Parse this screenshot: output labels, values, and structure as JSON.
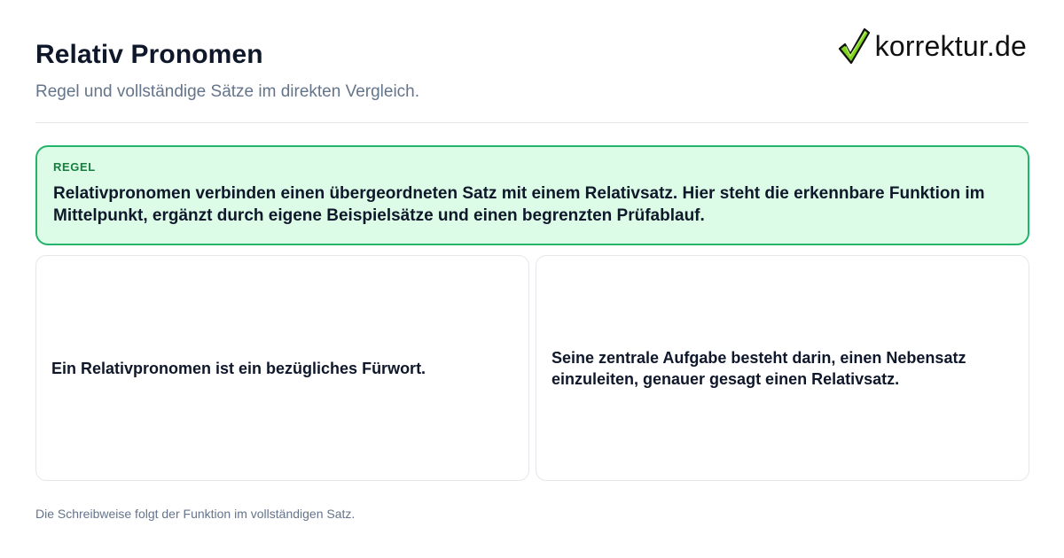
{
  "header": {
    "title": "Relativ Pronomen",
    "subtitle": "Regel und vollständige Sätze im direkten Vergleich."
  },
  "logo": {
    "icon": "checkmark-icon",
    "text": "korrektur.de",
    "check_color": "#7ed321"
  },
  "rule": {
    "label": "REGEL",
    "text": "Relativpronomen verbinden einen übergeordneten Satz mit einem Relativsatz. Hier steht die erkennbare Funktion im Mittelpunkt, ergänzt durch eigene Beispielsätze und einen begrenzten Prüfablauf."
  },
  "cards": [
    {
      "text": "Ein Relativpronomen ist ein bezügliches Fürwort."
    },
    {
      "text": "Seine zentrale Aufgabe besteht darin, einen Nebensatz einzuleiten, genauer gesagt einen Relativsatz."
    }
  ],
  "footer": {
    "note": "Die Schreibweise folgt der Funktion im vollständigen Satz."
  },
  "colors": {
    "accent_green": "#22b46a",
    "rule_background": "#dcfce7",
    "rule_label": "#15803d",
    "muted_text": "#64748b"
  }
}
